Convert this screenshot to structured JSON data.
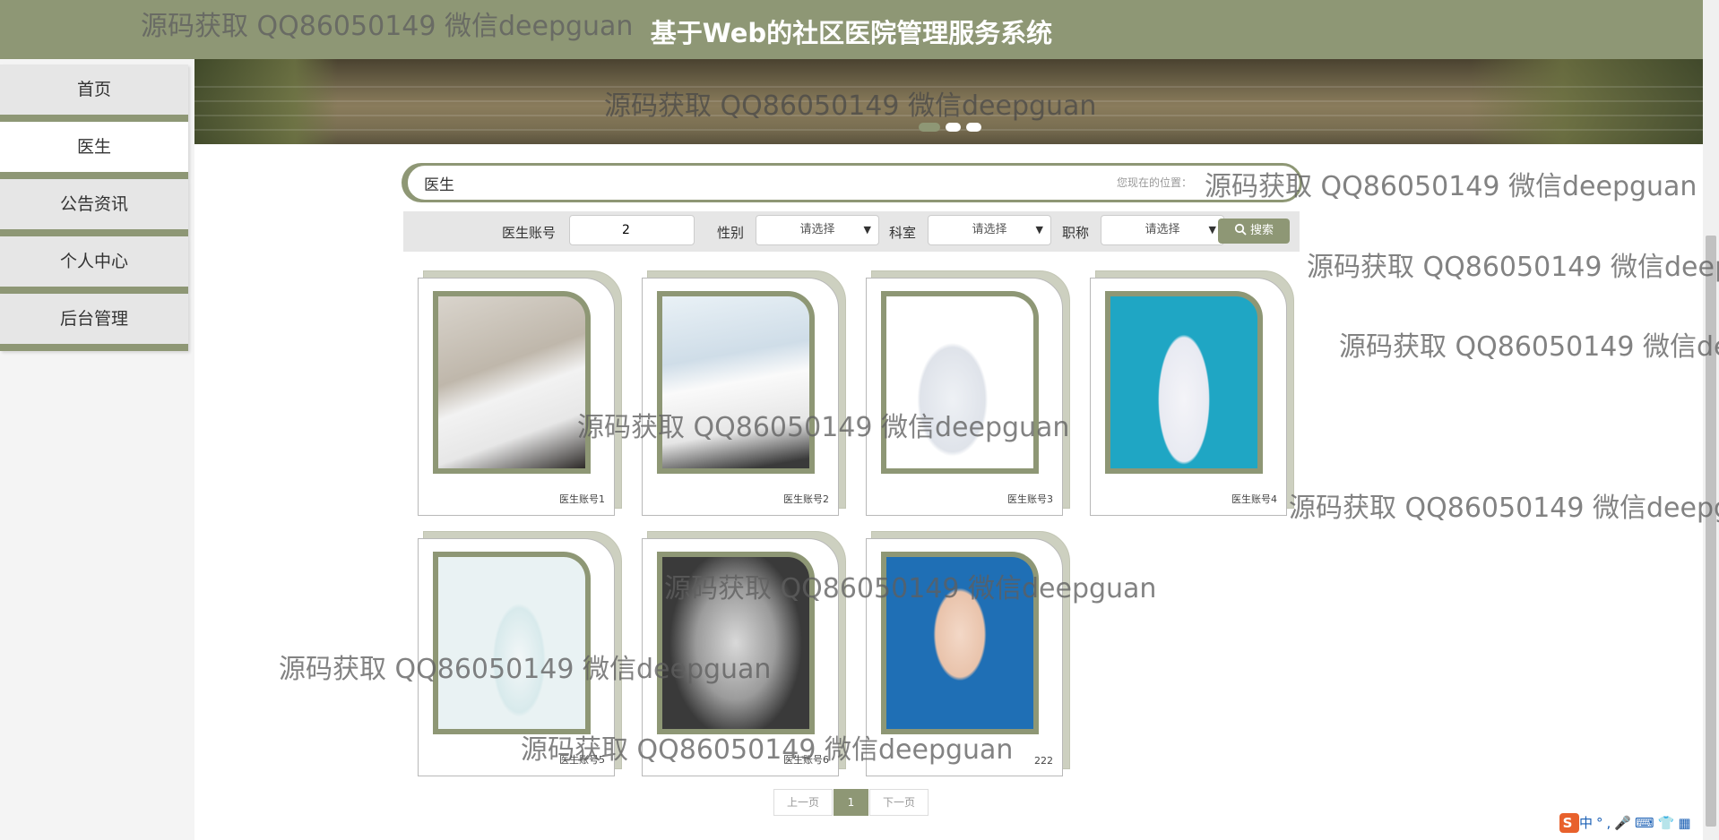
{
  "header": {
    "title": "基于Web的社区医院管理服务系统"
  },
  "watermark": "源码获取 QQ86050149 微信deepguan",
  "nav": {
    "items": [
      {
        "label": "首页",
        "active": false
      },
      {
        "label": "医生",
        "active": true
      },
      {
        "label": "公告资讯",
        "active": false
      },
      {
        "label": "个人中心",
        "active": false
      },
      {
        "label": "后台管理",
        "active": false
      }
    ]
  },
  "banner": {
    "dot_count": 3,
    "active_dot": 0
  },
  "section": {
    "title": "医生",
    "crumb": "您现在的位置："
  },
  "filters": {
    "account_label": "医生账号",
    "account_value": "2",
    "gender_label": "性别",
    "gender_value": "请选择",
    "dept_label": "科室",
    "dept_value": "请选择",
    "title_label": "职称",
    "title_value": "请选择",
    "search_label": "搜索"
  },
  "doctors": [
    {
      "caption": "医生账号1"
    },
    {
      "caption": "医生账号2"
    },
    {
      "caption": "医生账号3"
    },
    {
      "caption": "医生账号4"
    },
    {
      "caption": "医生账号5"
    },
    {
      "caption": "医生账号6"
    },
    {
      "caption": "222"
    }
  ],
  "pager": {
    "prev": "上一页",
    "current": "1",
    "next": "下一页"
  },
  "ime": {
    "lang": "中"
  },
  "colors": {
    "accent": "#8e9775",
    "sidebar_bg": "#e6e6e6"
  }
}
